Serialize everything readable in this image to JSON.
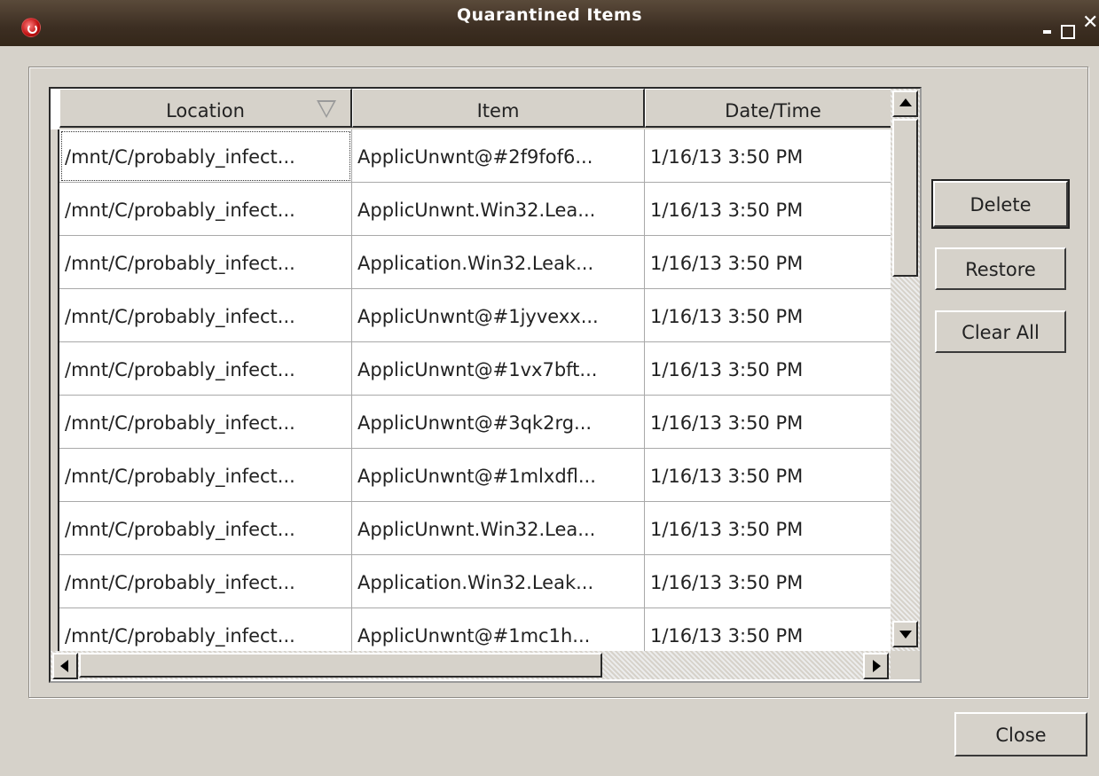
{
  "window": {
    "title": "Quarantined Items",
    "controls": [
      "minimize",
      "maximize",
      "close"
    ]
  },
  "table": {
    "columns": [
      "Location",
      "Item",
      "Date/Time"
    ],
    "sort_column": "Location",
    "rows": [
      {
        "location": "/mnt/C/probably_infect...",
        "item": "ApplicUnwnt@#2f9fof6...",
        "datetime": "1/16/13 3:50 PM"
      },
      {
        "location": "/mnt/C/probably_infect...",
        "item": "ApplicUnwnt.Win32.Lea...",
        "datetime": "1/16/13 3:50 PM"
      },
      {
        "location": "/mnt/C/probably_infect...",
        "item": "Application.Win32.Leak...",
        "datetime": "1/16/13 3:50 PM"
      },
      {
        "location": "/mnt/C/probably_infect...",
        "item": "ApplicUnwnt@#1jyvexx...",
        "datetime": "1/16/13 3:50 PM"
      },
      {
        "location": "/mnt/C/probably_infect...",
        "item": "ApplicUnwnt@#1vx7bft...",
        "datetime": "1/16/13 3:50 PM"
      },
      {
        "location": "/mnt/C/probably_infect...",
        "item": "ApplicUnwnt@#3qk2rg...",
        "datetime": "1/16/13 3:50 PM"
      },
      {
        "location": "/mnt/C/probably_infect...",
        "item": "ApplicUnwnt@#1mlxdfl...",
        "datetime": "1/16/13 3:50 PM"
      },
      {
        "location": "/mnt/C/probably_infect...",
        "item": "ApplicUnwnt.Win32.Lea...",
        "datetime": "1/16/13 3:50 PM"
      },
      {
        "location": "/mnt/C/probably_infect...",
        "item": "Application.Win32.Leak...",
        "datetime": "1/16/13 3:50 PM"
      },
      {
        "location": "/mnt/C/probably_infect...",
        "item": "ApplicUnwnt@#1mc1h...",
        "datetime": "1/16/13 3:50 PM"
      }
    ]
  },
  "buttons": {
    "delete": "Delete",
    "restore": "Restore",
    "clear_all": "Clear All",
    "close": "Close"
  },
  "colors": {
    "titlebar": "#3c2e22",
    "window_bg": "#d6d2ca",
    "table_bg": "#ffffff"
  }
}
